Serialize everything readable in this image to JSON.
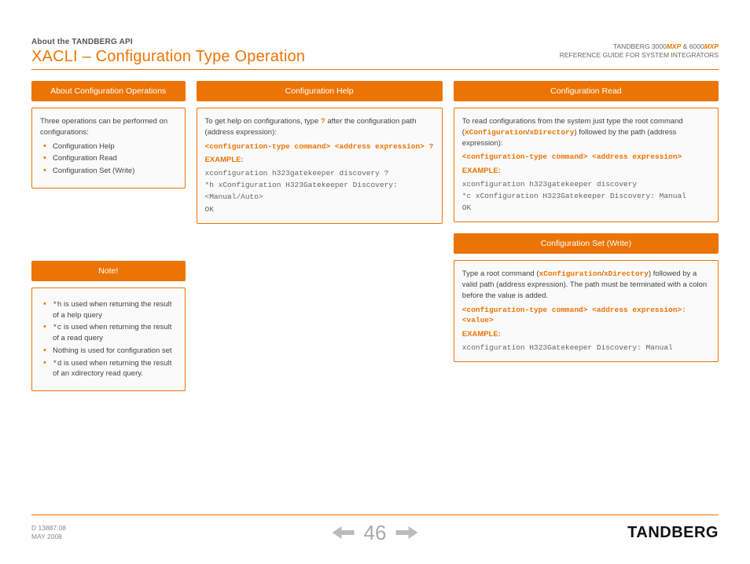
{
  "header": {
    "about_line": "About the TANDBERG API",
    "page_title": "XACLI – Configuration Type Operation",
    "product_line_prefix1": "TANDBERG 3000",
    "mxp1": "MXP",
    "amp": " & ",
    "product_line_prefix2": "6000",
    "mxp2": "MXP",
    "ref_guide": "REFERENCE GUIDE FOR SYSTEM INTEGRATORS"
  },
  "card_about": {
    "title": "About Configuration Operations",
    "intro": "Three operations can be performed on configurations:",
    "li1": "Configuration Help",
    "li2": "Configuration Read",
    "li3": "Configuration Set (Write)"
  },
  "card_note": {
    "title": "Note!",
    "li1_pre": "*h",
    "li1_post": " is used when returning the result of a help query",
    "li2_pre": "*c",
    "li2_post": " is used when returning the result of a read query",
    "li3": "Nothing is used for configuration set",
    "li4_pre": "*d",
    "li4_post": " is used when returning the result of an xdirectory read query."
  },
  "card_help": {
    "title": "Configuration Help",
    "intro_pre": "To get help on configurations, type ",
    "intro_q": "?",
    "intro_post": " after the configuration path (address expression):",
    "syntax": "<configuration-type command> <address expression> ?",
    "example_label": "EXAMPLE:",
    "code_line1": "xconfiguration h323gatekeeper discovery ?",
    "code_line2": "*h xConfiguration H323Gatekeeper Discovery: <Manual/Auto>",
    "code_line3": "OK"
  },
  "card_read": {
    "title": "Configuration Read",
    "intro_pre": "To read configurations from the system just type the root command (",
    "intro_x1": "xConfiguration",
    "intro_slash": "/",
    "intro_x2": "xDirectory",
    "intro_post": ") followed by the path (address expression):",
    "syntax": "<configuration-type command> <address expression>",
    "example_label": "EXAMPLE:",
    "code_line1": "xconfiguration h323gatekeeper discovery",
    "code_line2": "*c xConfiguration H323Gatekeeper Discovery: Manual",
    "code_line3": "OK"
  },
  "card_set": {
    "title": "Configuration Set (Write)",
    "intro_pre": "Type a root command (",
    "intro_x1": "xConfiguration",
    "intro_slash": "/",
    "intro_x2": "xDirectory",
    "intro_post": ") followed by a valid path (address expression). The path must be terminated with a colon before the value is added.",
    "syntax": "<configuration-type command> <address expression>: <value>",
    "example_label": "EXAMPLE:",
    "code_line1": "xconfiguration H323Gatekeeper Discovery: Manual"
  },
  "footer": {
    "doc_id": "D 13887.08",
    "doc_date": "MAY 2008",
    "page_num": "46",
    "brand": "TANDBERG"
  }
}
